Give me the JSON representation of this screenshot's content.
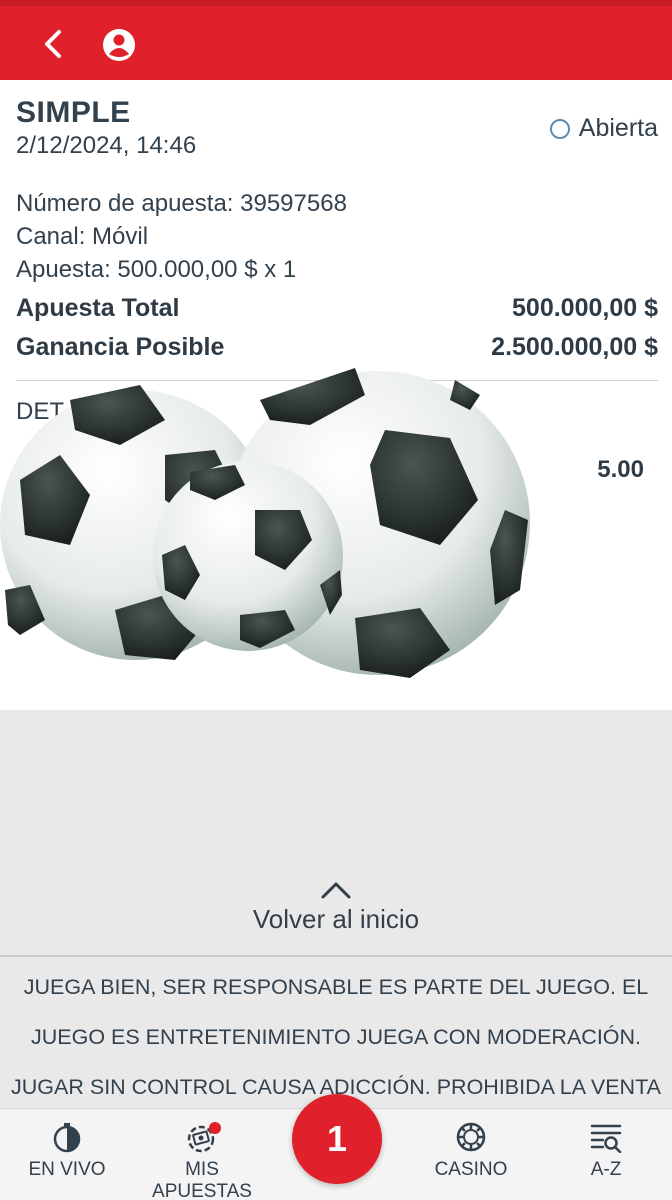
{
  "header": {
    "back_icon": "chevron-left-icon",
    "user_icon": "user-circle-icon",
    "background": "#e0202a"
  },
  "bet": {
    "type": "SIMPLE",
    "date": "2/12/2024, 14:46",
    "status": "Abierta",
    "number_line": "Número de apuesta: 39597568",
    "channel_line": "Canal: Móvil",
    "stake_line": "Apuesta: 500.000,00 $ x 1",
    "total_label": "Apuesta Total",
    "total_value": "500.000,00 $",
    "win_label": "Ganancia Posible",
    "win_value": "2.500.000,00 $",
    "details_label": "DET",
    "odds": "5.00"
  },
  "footer": {
    "back_to_top": "Volver al inicio",
    "disclaimer": [
      "JUEGA BIEN, SER RESPONSABLE ES PARTE DEL JUEGO. EL",
      "JUEGO ES ENTRETENIMIENTO JUEGA CON MODERACIÓN.",
      "JUGAR SIN CONTROL CAUSA ADICCIÓN. PROHIBIDA LA VENTA"
    ]
  },
  "nav": {
    "live": "EN VIVO",
    "my_bets": "MIS APUESTAS",
    "betslip_count": "1",
    "casino": "CASINO",
    "az": "A-Z"
  }
}
